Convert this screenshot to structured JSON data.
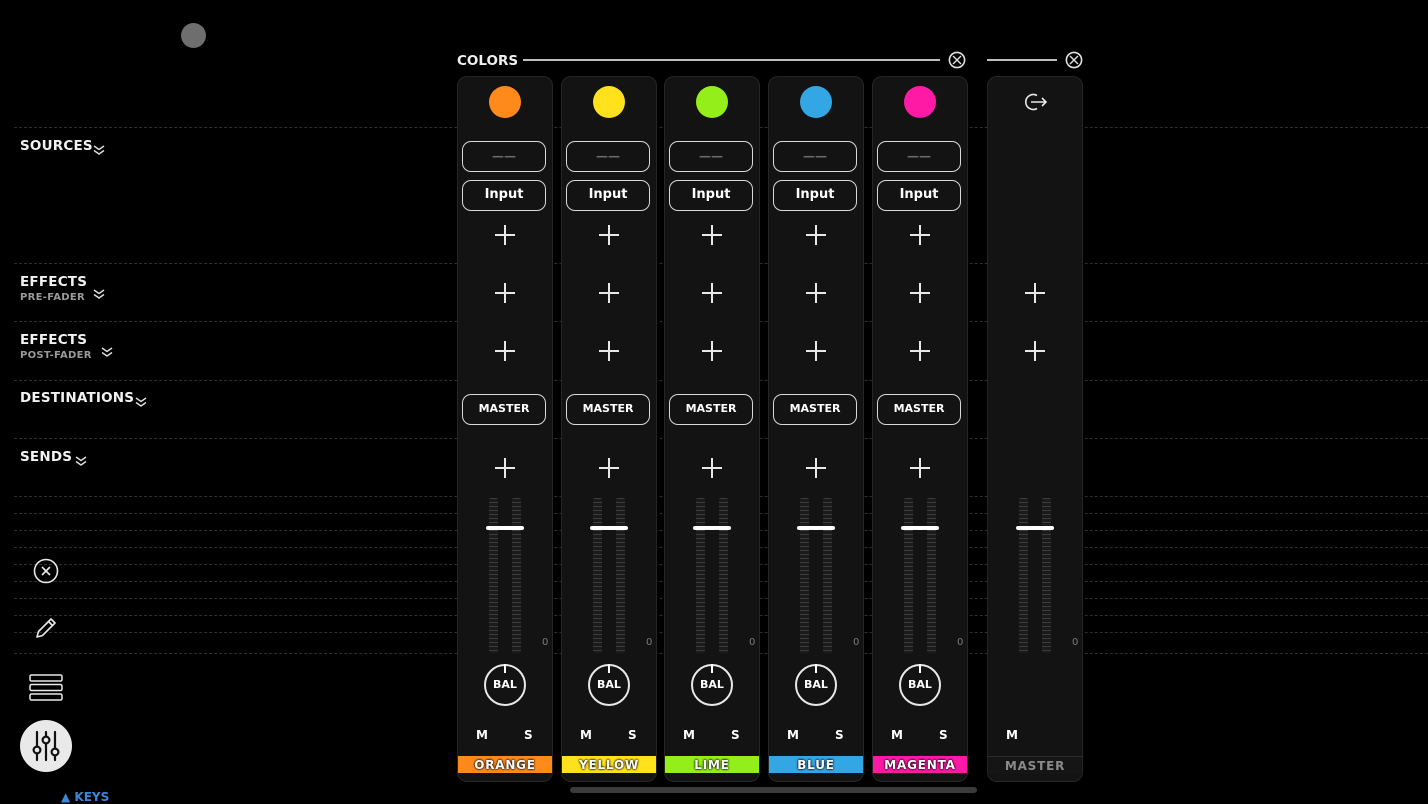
{
  "header": {
    "colors_label": "COLORS"
  },
  "sections": [
    {
      "label": "SOURCES",
      "sub": ""
    },
    {
      "label": "EFFECTS",
      "sub": "PRE-FADER"
    },
    {
      "label": "EFFECTS",
      "sub": "POST-FADER"
    },
    {
      "label": "DESTINATIONS",
      "sub": ""
    },
    {
      "label": "SENDS",
      "sub": ""
    }
  ],
  "channels": [
    {
      "name": "ORANGE",
      "color": "#ff8a1c",
      "source": "——",
      "input": "Input",
      "destination": "MASTER",
      "balance": "BAL",
      "mute": "M",
      "solo": "S",
      "meter_zero": "0",
      "fader_level": 0.8
    },
    {
      "name": "YELLOW",
      "color": "#ffe21c",
      "source": "——",
      "input": "Input",
      "destination": "MASTER",
      "balance": "BAL",
      "mute": "M",
      "solo": "S",
      "meter_zero": "0",
      "fader_level": 0.8
    },
    {
      "name": "LIME",
      "color": "#94ee1a",
      "source": "——",
      "input": "Input",
      "destination": "MASTER",
      "balance": "BAL",
      "mute": "M",
      "solo": "S",
      "meter_zero": "0",
      "fader_level": 0.8
    },
    {
      "name": "BLUE",
      "color": "#33a6e4",
      "source": "——",
      "input": "Input",
      "destination": "MASTER",
      "balance": "BAL",
      "mute": "M",
      "solo": "S",
      "meter_zero": "0",
      "fader_level": 0.8
    },
    {
      "name": "MAGENTA",
      "color": "#ff1aa6",
      "source": "——",
      "input": "Input",
      "destination": "MASTER",
      "balance": "BAL",
      "mute": "M",
      "solo": "S",
      "meter_zero": "0",
      "fader_level": 0.8
    }
  ],
  "master": {
    "name": "MASTER",
    "mute": "M",
    "meter_zero": "0",
    "fader_level": 0.8
  },
  "footer": {
    "keys_label": "▲ KEYS"
  },
  "icons": {
    "colors_header": "crossed-circle-icon",
    "master_header": "crossed-circle-icon",
    "master_output": "output-arrow-icon",
    "toolbar": [
      "close-circle-icon",
      "pencil-icon",
      "list-icon",
      "mixer-sliders-icon"
    ]
  }
}
